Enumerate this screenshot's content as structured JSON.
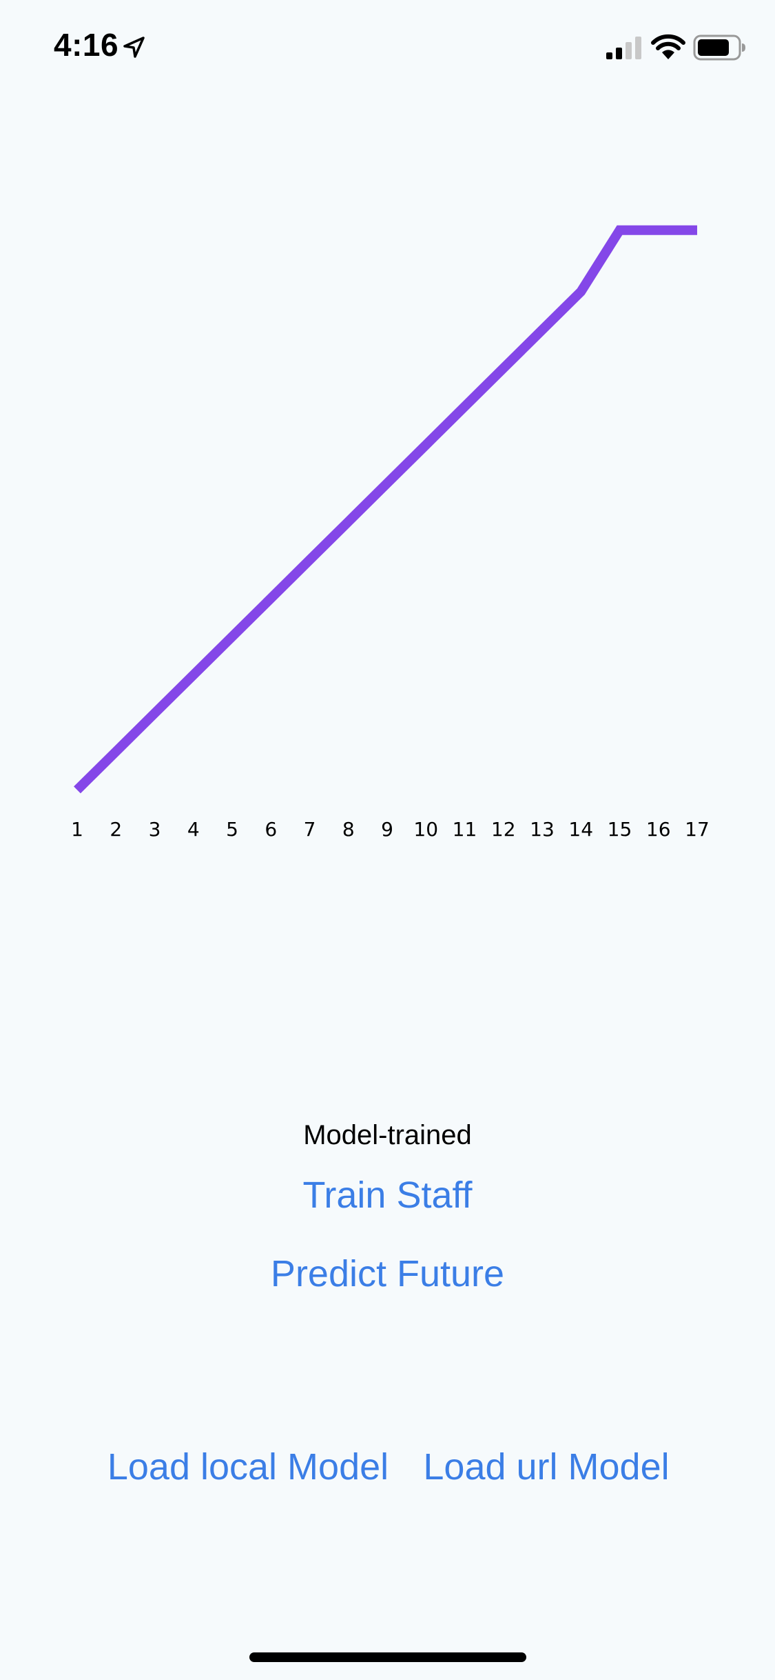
{
  "status_bar": {
    "time": "4:16",
    "icons": [
      "location-arrow-icon",
      "cellular-signal-icon",
      "wifi-icon",
      "battery-icon"
    ]
  },
  "chart_data": {
    "type": "line",
    "x": [
      1,
      2,
      3,
      4,
      5,
      6,
      7,
      8,
      9,
      10,
      11,
      12,
      13,
      14,
      15,
      16,
      17
    ],
    "series": [
      {
        "values": [
          1,
          2,
          3,
          4,
          5,
          6,
          7,
          8,
          9,
          10,
          11,
          12,
          13,
          14,
          15.6,
          15.6,
          15.6
        ]
      }
    ],
    "ylim": [
      0,
      17
    ],
    "grid": false,
    "color": "#8447e8"
  },
  "labels": {
    "model_status": "Model-trained",
    "train_button": "Train Staff",
    "predict_button": "Predict Future",
    "load_local_button": "Load local Model",
    "load_url_button": "Load url Model"
  },
  "colors": {
    "background": "#f6fafc",
    "link": "#3b7ee6",
    "line": "#8447e8"
  }
}
